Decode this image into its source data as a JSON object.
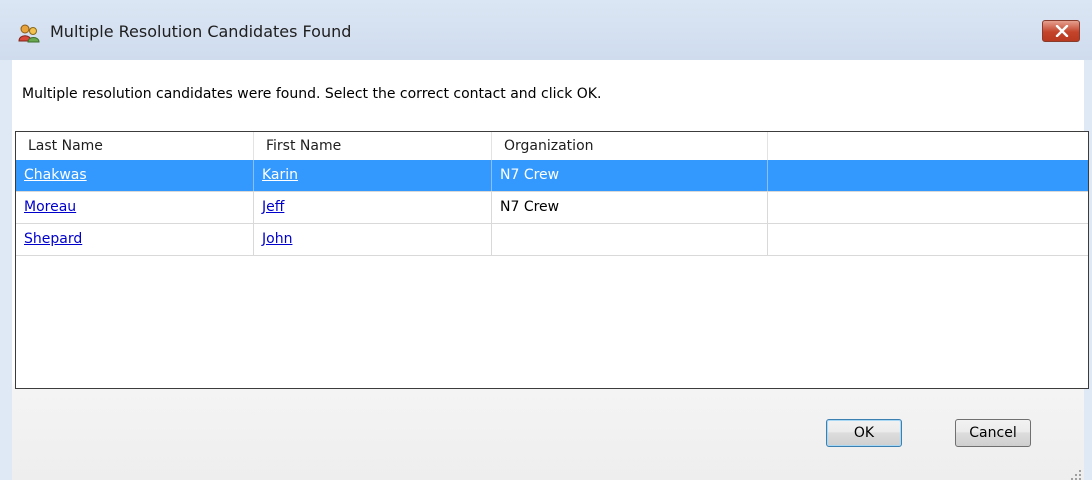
{
  "window": {
    "title": "Multiple Resolution Candidates Found",
    "icon": "contacts-app-icon",
    "close_icon": "close-icon"
  },
  "instruction": "Multiple resolution candidates were found.  Select the correct contact and click OK.",
  "grid": {
    "columns": [
      "Last Name",
      "First Name",
      "Organization",
      ""
    ],
    "rows": [
      {
        "last_name": "Chakwas",
        "first_name": "Karin",
        "organization": "N7 Crew",
        "selected": true
      },
      {
        "last_name": "Moreau",
        "first_name": "Jeff",
        "organization": "N7 Crew",
        "selected": false
      },
      {
        "last_name": "Shepard",
        "first_name": "John",
        "organization": "",
        "selected": false
      }
    ]
  },
  "buttons": {
    "ok": "OK",
    "cancel": "Cancel"
  },
  "colors": {
    "selection": "#3399ff",
    "link": "#0000cc",
    "close_button": "#c3442b"
  }
}
